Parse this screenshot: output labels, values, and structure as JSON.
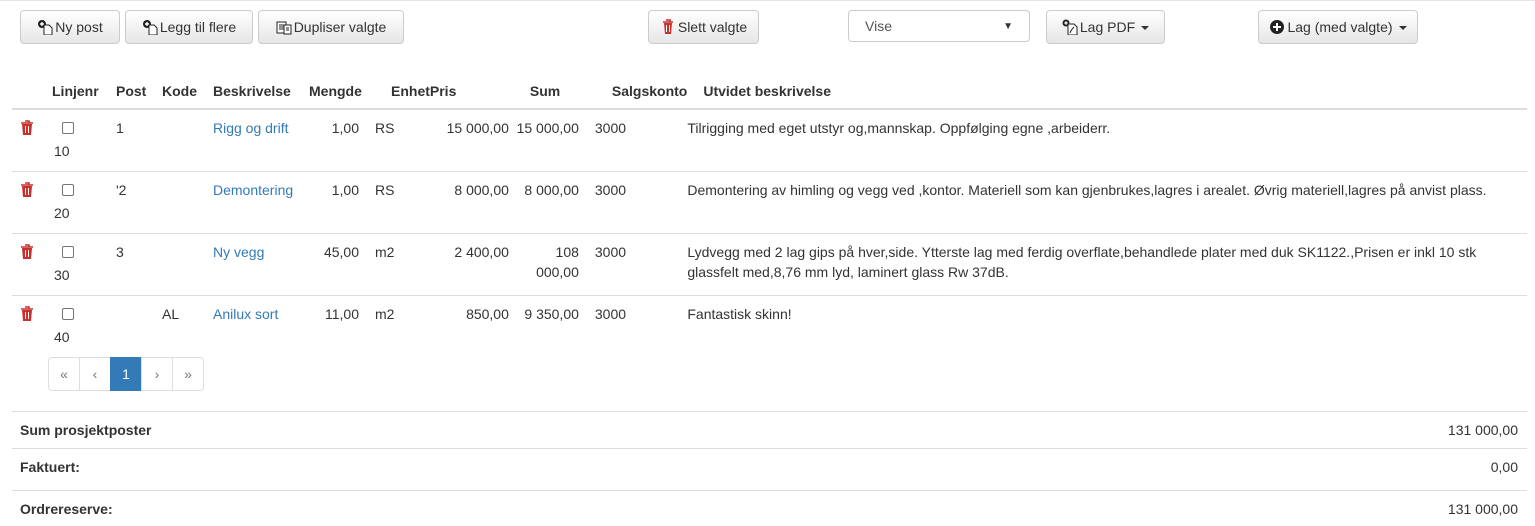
{
  "toolbar": {
    "new_post": "Ny post",
    "add_more": "Legg til flere",
    "duplicate": "Dupliser valgte",
    "delete": "Slett valgte",
    "view_select": "Vise",
    "make_pdf": "Lag PDF",
    "make_with_selected": "Lag (med valgte)"
  },
  "table": {
    "headers": [
      "Linjenr",
      "Post",
      "Kode",
      "Beskrivelse",
      "Mengde",
      "Enhet",
      "Pris",
      "Sum",
      "Salgskonto",
      "Utvidet beskrivelse"
    ],
    "rows": [
      {
        "linjenr": "10",
        "post": "1",
        "kode": "",
        "beskrivelse": "Rigg og drift",
        "mengde": "1,00",
        "enhet": "RS",
        "pris": "15 000,00",
        "sum": "15 000,00",
        "salgskonto": "3000",
        "utvidet": "Tilrigging med eget utstyr og,mannskap. Oppfølging egne ,arbeiderr."
      },
      {
        "linjenr": "20",
        "post": "'2",
        "kode": "",
        "beskrivelse": "Demontering",
        "mengde": "1,00",
        "enhet": "RS",
        "pris": "8 000,00",
        "sum": "8 000,00",
        "salgskonto": "3000",
        "utvidet": "Demontering av himling og vegg ved ,kontor. Materiell som kan gjenbrukes,lagres i arealet. Øvrig materiell,lagres på anvist plass."
      },
      {
        "linjenr": "30",
        "post": "3",
        "kode": "",
        "beskrivelse": "Ny vegg",
        "mengde": "45,00",
        "enhet": "m2",
        "pris": "2 400,00",
        "sum": "108 000,00",
        "salgskonto": "3000",
        "utvidet": "Lydvegg med 2 lag gips på hver,side. Ytterste lag med ferdig overflate,behandlede plater med duk SK1122.,Prisen er inkl 10 stk glassfelt med,8,76 mm lyd, laminert glass Rw 37dB."
      },
      {
        "linjenr": "40",
        "post": "",
        "kode": "AL",
        "beskrivelse": "Anilux sort",
        "mengde": "11,00",
        "enhet": "m2",
        "pris": "850,00",
        "sum": "9 350,00",
        "salgskonto": "3000",
        "utvidet": "Fantastisk skinn!"
      }
    ]
  },
  "pager": {
    "first": "«",
    "prev": "‹",
    "current": "1",
    "next": "›",
    "last": "»"
  },
  "summary": {
    "sum_label": "Sum prosjektposter",
    "sum_value": "131 000,00",
    "invoiced_label": "Faktuert:",
    "invoiced_value": "0,00",
    "reserve_label": "Ordrereserve:",
    "reserve_value": "131 000,00"
  },
  "colors": {
    "link": "#337ab7",
    "trash": "#c9302c",
    "active_page": "#337ab7"
  }
}
